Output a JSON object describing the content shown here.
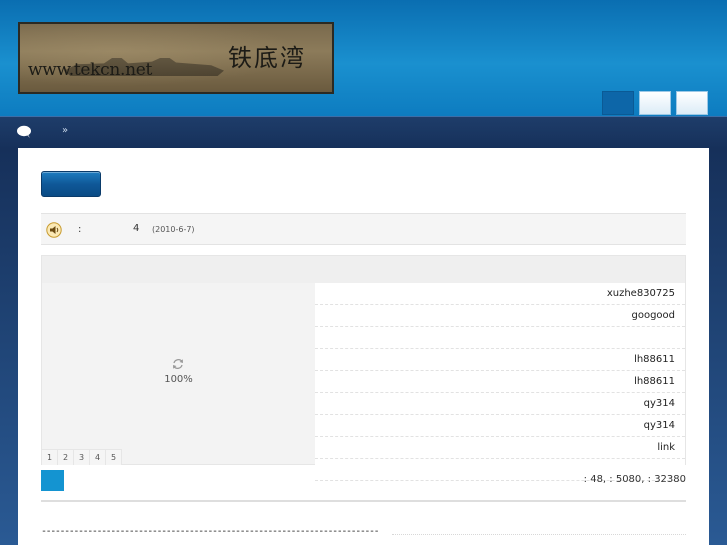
{
  "header": {
    "logo_url_text": "www.tekcn.net",
    "logo_chinese_text": "铁底湾"
  },
  "navbar": {
    "icon": "chat-bubble-icon",
    "separator": "»"
  },
  "notice": {
    "icon": "speaker-icon",
    "colon": ":",
    "count": "4",
    "date": "(2010-6-7)"
  },
  "slideshow": {
    "icon": "reload-icon",
    "progress_text": "100%",
    "pages": [
      "1",
      "2",
      "3",
      "4",
      "5"
    ]
  },
  "user_list": [
    "xuzhe830725",
    "googood",
    "",
    "lh88611",
    "lh88611",
    "qy314",
    "qy314",
    "link",
    ""
  ],
  "stats": {
    "text": ": 48,  : 5080,  : 32380"
  },
  "footer": {
    "dashes": "-------------------------------------------------------------------------"
  },
  "colors": {
    "header_blue": "#1a90cf",
    "navbar_dark": "#16305a",
    "accent_blue": "#1494d1"
  }
}
